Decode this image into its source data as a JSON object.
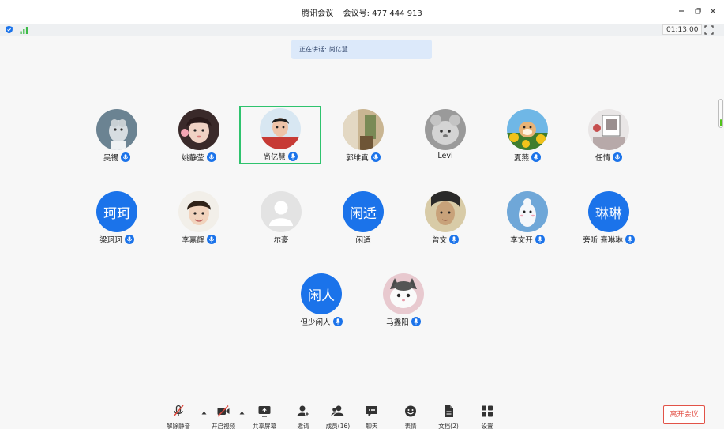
{
  "window": {
    "app_name": "腾讯会议",
    "meeting_label": "会议号:",
    "meeting_id": "477 444 913"
  },
  "status_bar": {
    "timer": "01:13:00"
  },
  "speaking_banner": {
    "label": "正在讲话:",
    "speaker": "尚亿慧"
  },
  "participants": [
    {
      "name": "吴锡",
      "avatar": "photo",
      "mic": true
    },
    {
      "name": "姚静莹",
      "avatar": "photo",
      "mic": true
    },
    {
      "name": "尚亿慧",
      "avatar": "photo",
      "mic": true,
      "speaking": true
    },
    {
      "name": "郭维真",
      "avatar": "photo",
      "mic": true
    },
    {
      "name": "Levi",
      "avatar": "photo",
      "mic": false
    },
    {
      "name": "夏燕",
      "avatar": "photo",
      "mic": true
    },
    {
      "name": "任情",
      "avatar": "photo",
      "mic": true
    },
    {
      "name": "梁珂珂",
      "avatar": "text",
      "avatar_text": "珂珂",
      "mic": true
    },
    {
      "name": "李嘉辉",
      "avatar": "photo",
      "mic": true
    },
    {
      "name": "尔豪",
      "avatar": "default",
      "mic": false
    },
    {
      "name": "闲适",
      "avatar": "text",
      "avatar_text": "闲适",
      "mic": false
    },
    {
      "name": "曾文",
      "avatar": "photo",
      "mic": true
    },
    {
      "name": "李文开",
      "avatar": "photo",
      "mic": true
    },
    {
      "name": "旁听 熹琳琳",
      "avatar": "text",
      "avatar_text": "琳琳",
      "mic": true
    },
    {
      "name": "但少闲人",
      "avatar": "text",
      "avatar_text": "闲人",
      "mic": true
    },
    {
      "name": "马鑫阳",
      "avatar": "photo",
      "mic": true
    }
  ],
  "toolbar": {
    "unmute": "解除静音",
    "start_video": "开启视频",
    "share_screen": "共享屏幕",
    "invite": "邀请",
    "members": "成员(16)",
    "chat": "聊天",
    "reactions": "表情",
    "documents": "文档(2)",
    "settings": "设置",
    "leave": "离开会议"
  },
  "colors": {
    "accent": "#1b73ea",
    "speaking_border": "#2fc36e",
    "leave_red": "#e14a3f",
    "banner_bg": "#dce9fa"
  }
}
